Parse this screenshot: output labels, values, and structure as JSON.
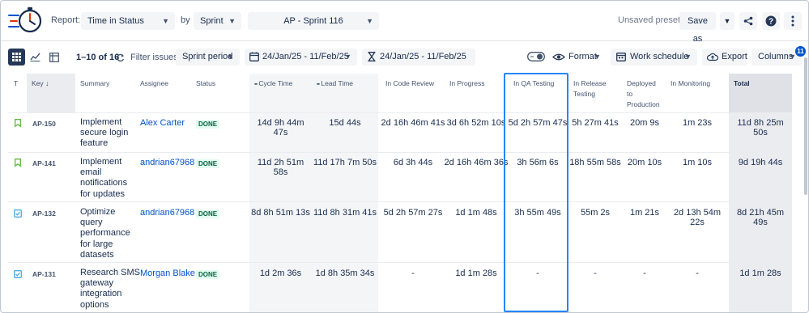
{
  "topbar": {
    "report_label": "Report:",
    "report_value": "Time in Status",
    "by_label": "by",
    "by_value": "Sprint",
    "sprint_value": "AP - Sprint 116",
    "unsaved": "Unsaved preset",
    "save_as": "Save as"
  },
  "toolbar": {
    "range": "1–10 of",
    "total": "16",
    "filter_label": "Filter issues:",
    "filter_value": "Sprint period",
    "date1": "24/Jan/25 - 11/Feb/25",
    "date2": "24/Jan/25 - 11/Feb/25",
    "format": "Format",
    "work_schedule": "Work schedule",
    "export": "Export",
    "columns": "Columns",
    "columns_badge": "11"
  },
  "table": {
    "headers": {
      "t": "T",
      "key": "Key",
      "summary": "Summary",
      "assignee": "Assignee",
      "status": "Status",
      "cycle": "Cycle Time",
      "lead": "Lead Time",
      "code_review": "In Code Review",
      "in_progress": "In Progress",
      "qa": "In QA Testing",
      "release_1": "In Release",
      "release_2": "Testing",
      "deployed_1": "Deployed",
      "deployed_2": "to",
      "deployed_3": "Production",
      "monitoring": "In Monitoring",
      "total": "Total"
    },
    "rows": [
      {
        "type": "story",
        "key": "AP-150",
        "summary": [
          "Implement",
          "secure login",
          "feature"
        ],
        "assignee": "Alex Carter",
        "status": "DONE",
        "cycle": "14d 9h 44m 47s",
        "lead": "15d 44s",
        "code_review": "2d 16h 46m 41s",
        "in_progress": "3d 6h 52m 10s",
        "qa": "5d 2h 57m 47s",
        "release": "5h 27m 41s",
        "deployed": "20m 9s",
        "monitoring": "1m 23s",
        "total": "11d 8h 25m 50s"
      },
      {
        "type": "story",
        "key": "AP-141",
        "summary": [
          "Implement",
          "email",
          "notifications",
          "for updates"
        ],
        "assignee": "andrian67968",
        "status": "DONE",
        "cycle": "11d 2h 51m 58s",
        "lead": "11d 17h 7m 50s",
        "code_review": "6d 3h 44s",
        "in_progress": "2d 16h 46m 36s",
        "qa": "3h 56m 6s",
        "release": "18h 55m 58s",
        "deployed": "20m 10s",
        "monitoring": "1m 10s",
        "total": "9d 19h 44s"
      },
      {
        "type": "task",
        "key": "AP-132",
        "summary": [
          "Optimize",
          "query",
          "performance",
          "for large",
          "datasets"
        ],
        "assignee": "andrian67968",
        "status": "DONE",
        "cycle": "8d 8h 51m 13s",
        "lead": "11d 8h 31m 41s",
        "code_review": "5d 2h 57m 27s",
        "in_progress": "1d 1m 48s",
        "qa": "3h 55m 49s",
        "release": "55m 2s",
        "deployed": "1m 21s",
        "monitoring": "2d 13h 54m 22s",
        "total": "8d 21h 45m 49s"
      },
      {
        "type": "task",
        "key": "AP-131",
        "summary": [
          "Research SMS",
          "gateway",
          "integration",
          "options"
        ],
        "assignee": "Morgan Blake",
        "status": "DONE",
        "cycle": "1d 2m 36s",
        "lead": "1d 8h 35m 34s",
        "code_review": "-",
        "in_progress": "1d 1m 28s",
        "qa": "-",
        "release": "-",
        "deployed": "-",
        "monitoring": "-",
        "total": "1d 1m 28s"
      }
    ]
  },
  "colors": {
    "accent": "#0052cc",
    "done_bg": "#e3fcef",
    "done_fg": "#006644",
    "highlight": "#2684ff",
    "story_icon": "#63ba3c",
    "task_icon": "#4bade8"
  },
  "icons": {
    "logo": "stopwatch-logo",
    "share": "share-icon",
    "help": "help-icon",
    "more": "more-vertical-icon",
    "calendar": "calendar-icon",
    "hourglass": "hourglass-icon",
    "toggle": "toggle-icon",
    "eye": "eye-icon",
    "schedule": "schedule-icon",
    "cloud": "cloud-upload-icon",
    "refresh": "refresh-icon"
  }
}
